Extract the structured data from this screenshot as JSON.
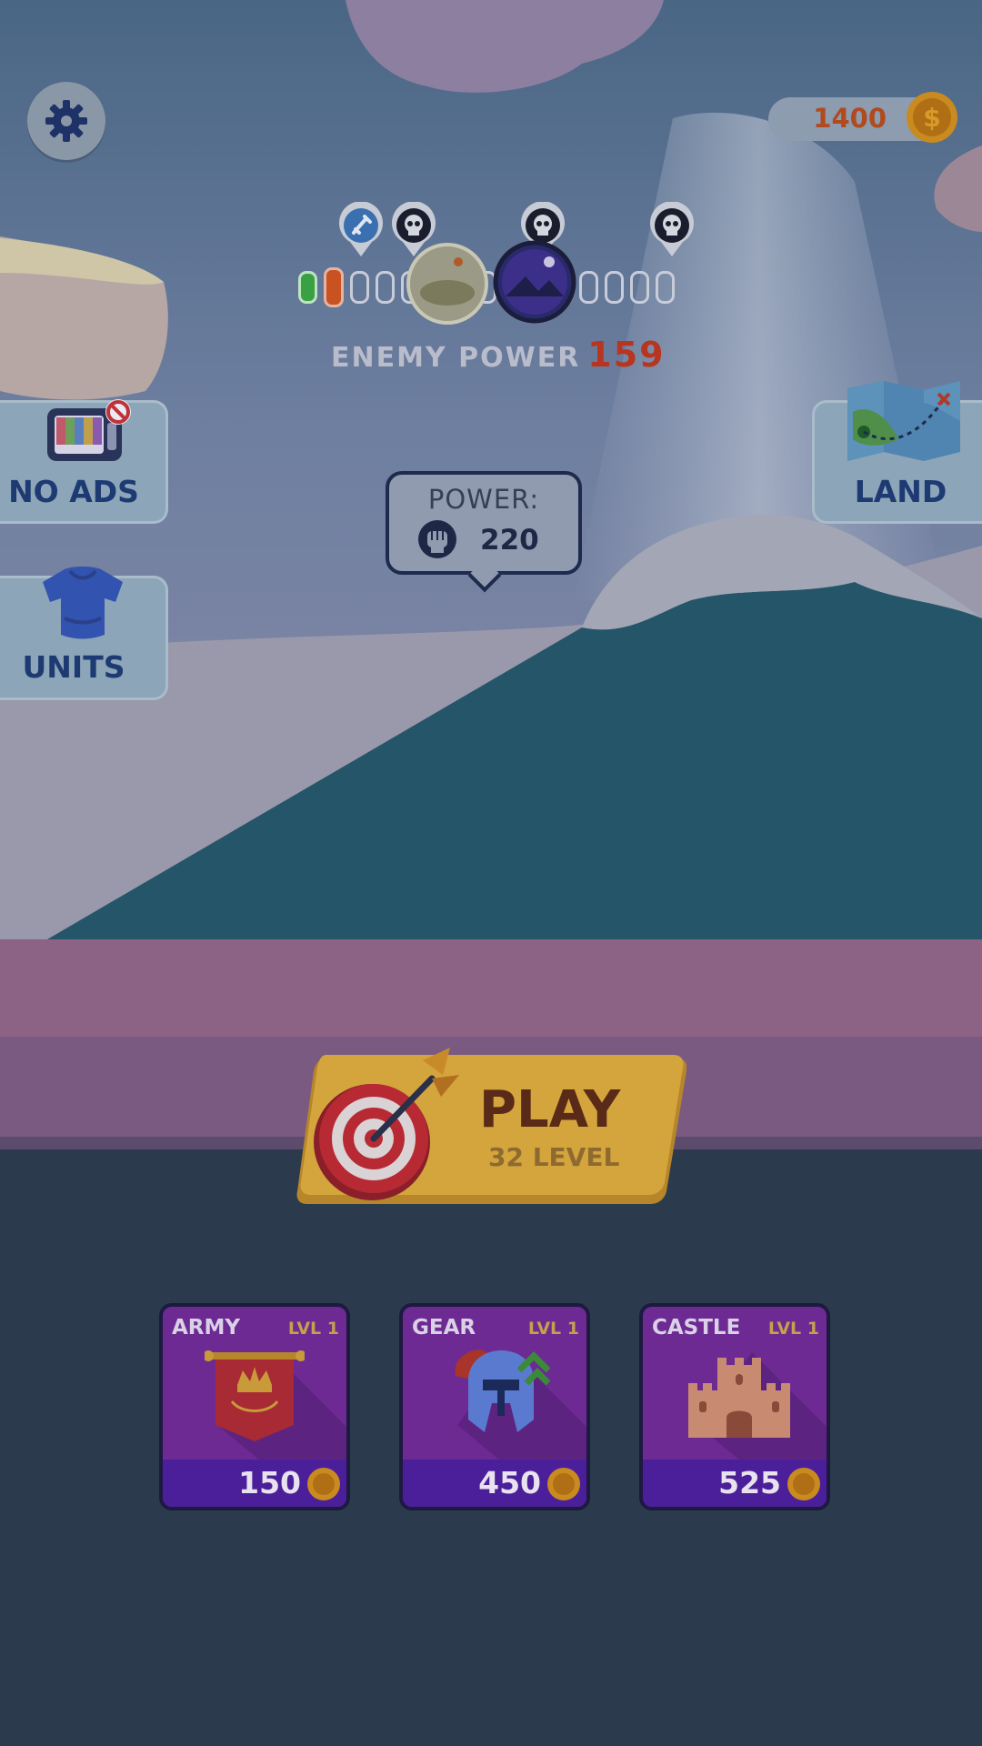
{
  "colors": {
    "sky": "#5a7393",
    "mountain": "#245569",
    "ground_band": "#8c6285",
    "bottom_panel": "#2b3a4c",
    "accent_text": "#1e3a72",
    "enemy_value": "#b8351f",
    "play_button": "#d3a53c",
    "card_purple": "#6d2a93"
  },
  "header": {
    "settings_icon": "gear-icon",
    "coins": "1400",
    "coin_icon": "coin-icon"
  },
  "progress": {
    "enemy_label": "ENEMY POWER",
    "enemy_value": "159",
    "segment_count": 15,
    "completed_segments": 1,
    "current_segment": 2
  },
  "side_buttons": {
    "no_ads": "NO ADS",
    "units": "UNITS",
    "land": "LAND"
  },
  "power": {
    "label": "POWER:",
    "value": "220"
  },
  "play": {
    "label": "PLAY",
    "level": "32 LEVEL"
  },
  "upgrades": [
    {
      "title": "ARMY",
      "level": "LVL 1",
      "price": "150",
      "icon": "banner-icon"
    },
    {
      "title": "GEAR",
      "level": "LVL 1",
      "price": "450",
      "icon": "helmet-icon"
    },
    {
      "title": "CASTLE",
      "level": "LVL 1",
      "price": "525",
      "icon": "castle-icon"
    }
  ]
}
